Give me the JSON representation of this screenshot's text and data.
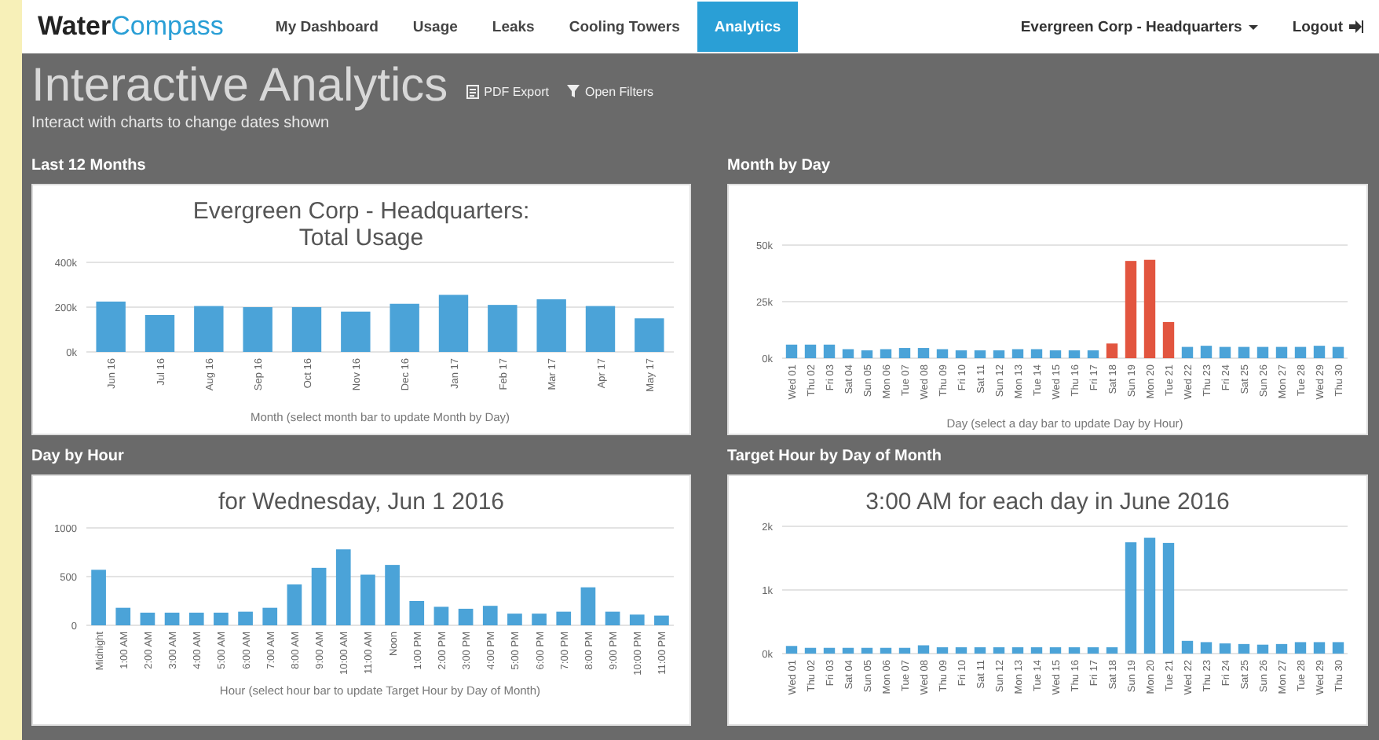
{
  "nav": {
    "logo_primary": "Water",
    "logo_accent": "Compass",
    "tabs": [
      {
        "label": "My Dashboard",
        "selected": false
      },
      {
        "label": "Usage",
        "selected": false
      },
      {
        "label": "Leaks",
        "selected": false
      },
      {
        "label": "Cooling Towers",
        "selected": false
      },
      {
        "label": "Analytics",
        "selected": true
      }
    ],
    "account": "Evergreen Corp - Headquarters",
    "logout": "Logout"
  },
  "header": {
    "title": "Interactive Analytics",
    "pdf_export": "PDF Export",
    "open_filters": "Open Filters",
    "subtitle": "Interact with charts to change dates shown"
  },
  "panels": [
    {
      "label": "Last 12 Months",
      "chart_data": {
        "type": "bar",
        "title": "Evergreen Corp - Headquarters:\nTotal Usage",
        "xlabel": "Month (select month bar to update Month by Day)",
        "categories": [
          "Jun 16",
          "Jul 16",
          "Aug 16",
          "Sep 16",
          "Oct 16",
          "Nov 16",
          "Dec 16",
          "Jan 17",
          "Feb 17",
          "Mar 17",
          "Apr 17",
          "May 17"
        ],
        "series": [
          {
            "color": "#4ba3d8",
            "values": [
              225000,
              165000,
              205000,
              200000,
              200000,
              180000,
              215000,
              255000,
              210000,
              235000,
              205000,
              150000
            ]
          }
        ],
        "ylim": [
          0,
          400000
        ],
        "yticks": [
          {
            "value": 0,
            "label": "0k"
          },
          {
            "value": 200000,
            "label": "200k"
          },
          {
            "value": 400000,
            "label": "400k"
          }
        ]
      }
    },
    {
      "label": "Month by Day",
      "chart_data": {
        "type": "bar",
        "xlabel": "Day (select a day bar to update Day by Hour)",
        "categories": [
          "Wed 01",
          "Thu 02",
          "Fri 03",
          "Sat 04",
          "Sun 05",
          "Mon 06",
          "Tue 07",
          "Wed 08",
          "Thu 09",
          "Fri 10",
          "Sat 11",
          "Sun 12",
          "Mon 13",
          "Tue 14",
          "Wed 15",
          "Thu 16",
          "Fri 17",
          "Sat 18",
          "Sun 19",
          "Mon 20",
          "Tue 21",
          "Wed 22",
          "Thu 23",
          "Fri 24",
          "Sat 25",
          "Sun 26",
          "Mon 27",
          "Tue 28",
          "Wed 29",
          "Thu 30"
        ],
        "series": [
          {
            "color": "#4ba3d8",
            "values": [
              6000,
              6000,
              6000,
              4000,
              3500,
              4000,
              4500,
              4500,
              4000,
              3500,
              3500,
              3500,
              4000,
              4000,
              3500,
              3500,
              3500,
              null,
              null,
              null,
              null,
              5000,
              5500,
              5000,
              5000,
              5000,
              5000,
              5000,
              5500,
              5000
            ]
          },
          {
            "color": "#e2553f",
            "values": [
              null,
              null,
              null,
              null,
              null,
              null,
              null,
              null,
              null,
              null,
              null,
              null,
              null,
              null,
              null,
              null,
              null,
              6500,
              43000,
              43500,
              16000,
              null,
              null,
              null,
              null,
              null,
              null,
              null,
              null,
              null
            ]
          }
        ],
        "ylim": [
          0,
          50000
        ],
        "yticks": [
          {
            "value": 0,
            "label": "0k"
          },
          {
            "value": 25000,
            "label": "25k"
          },
          {
            "value": 50000,
            "label": "50k"
          }
        ]
      }
    },
    {
      "label": "Day by Hour",
      "chart_data": {
        "type": "bar",
        "title": "for Wednesday, Jun 1 2016",
        "xlabel": "Hour (select hour bar to update Target Hour by Day of Month)",
        "categories": [
          "Midnight",
          "1:00 AM",
          "2:00 AM",
          "3:00 AM",
          "4:00 AM",
          "5:00 AM",
          "6:00 AM",
          "7:00 AM",
          "8:00 AM",
          "9:00 AM",
          "10:00 AM",
          "11:00 AM",
          "Noon",
          "1:00 PM",
          "2:00 PM",
          "3:00 PM",
          "4:00 PM",
          "5:00 PM",
          "6:00 PM",
          "7:00 PM",
          "8:00 PM",
          "9:00 PM",
          "10:00 PM",
          "11:00 PM"
        ],
        "series": [
          {
            "color": "#4ba3d8",
            "values": [
              570,
              180,
              130,
              130,
              130,
              130,
              140,
              180,
              420,
              590,
              780,
              520,
              620,
              250,
              190,
              170,
              200,
              120,
              120,
              140,
              390,
              140,
              110,
              100
            ]
          }
        ],
        "ylim": [
          0,
          1000
        ],
        "yticks": [
          0,
          500,
          1000
        ]
      }
    },
    {
      "label": "Target Hour by Day of Month",
      "chart_data": {
        "type": "bar",
        "title": "3:00 AM for each day in June 2016",
        "categories": [
          "Wed 01",
          "Thu 02",
          "Fri 03",
          "Sat 04",
          "Sun 05",
          "Mon 06",
          "Tue 07",
          "Wed 08",
          "Thu 09",
          "Fri 10",
          "Sat 11",
          "Sun 12",
          "Mon 13",
          "Tue 14",
          "Wed 15",
          "Thu 16",
          "Fri 17",
          "Sat 18",
          "Sun 19",
          "Mon 20",
          "Tue 21",
          "Wed 22",
          "Thu 23",
          "Fri 24",
          "Sat 25",
          "Sun 26",
          "Mon 27",
          "Tue 28",
          "Wed 29",
          "Thu 30"
        ],
        "series": [
          {
            "color": "#4ba3d8",
            "values": [
              120,
              90,
              90,
              90,
              90,
              90,
              90,
              130,
              100,
              100,
              100,
              100,
              100,
              100,
              100,
              100,
              100,
              100,
              1750,
              1820,
              1740,
              200,
              180,
              160,
              150,
              140,
              150,
              180,
              180,
              180
            ]
          }
        ],
        "ylim": [
          0,
          2000
        ],
        "yticks": [
          {
            "value": 0,
            "label": "0k"
          },
          {
            "value": 1000,
            "label": "1k"
          },
          {
            "value": 2000,
            "label": "2k"
          }
        ]
      }
    }
  ]
}
